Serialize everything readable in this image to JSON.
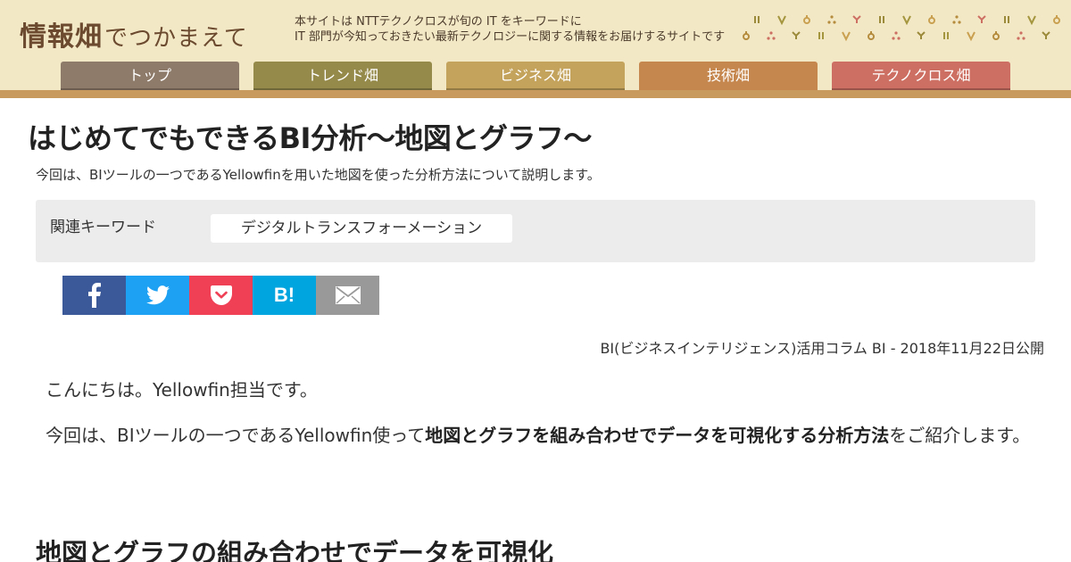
{
  "site": {
    "logo_main": "情報畑",
    "logo_sub": "でつかまえて",
    "tagline_line1": "本サイトは NTTテクノクロスが旬の IT をキーワードに",
    "tagline_line2": "IT 部門が今知っておきたい最新テクノロジーに関する情報をお届けするサイトです"
  },
  "nav": {
    "tabs": [
      {
        "label": "トップ",
        "color": "#8f7b6a"
      },
      {
        "label": "トレンド畑",
        "color": "#958a4a"
      },
      {
        "label": "ビジネス畑",
        "color": "#c4a35c"
      },
      {
        "label": "技術畑",
        "color": "#c6874e",
        "active": true
      },
      {
        "label": "テクノクロス畑",
        "color": "#cd6f62"
      }
    ]
  },
  "article": {
    "title": "はじめてでもできるBI分析～地図とグラフ～",
    "lead": "今回は、BIツールの一つであるYellowfinを用いた地図を使った分析方法について説明します。",
    "keyword_label": "関連キーワード",
    "keyword_tag": "デジタルトランスフォーメーション",
    "meta": "BI(ビジネスインテリジェンス)活用コラム BI - 2018年11月22日公開",
    "para1": "こんにちは。Yellowfin担当です。",
    "para2_before": "今回は、BIツールの一つであるYellowfin使って",
    "para2_bold": "地図とグラフを組み合わせでデータを可視化する分析方法",
    "para2_after": "をご紹介します。",
    "h2": "地図とグラフの組み合わせでデータを可視化"
  },
  "share": [
    {
      "icon": "facebook-icon",
      "color": "#3b5998"
    },
    {
      "icon": "twitter-icon",
      "color": "#1da1f2"
    },
    {
      "icon": "pocket-icon",
      "color": "#ef4056"
    },
    {
      "icon": "hatena-bookmark-icon",
      "color": "#00a4de",
      "text": "B!"
    },
    {
      "icon": "mail-icon",
      "color": "#999999"
    }
  ]
}
